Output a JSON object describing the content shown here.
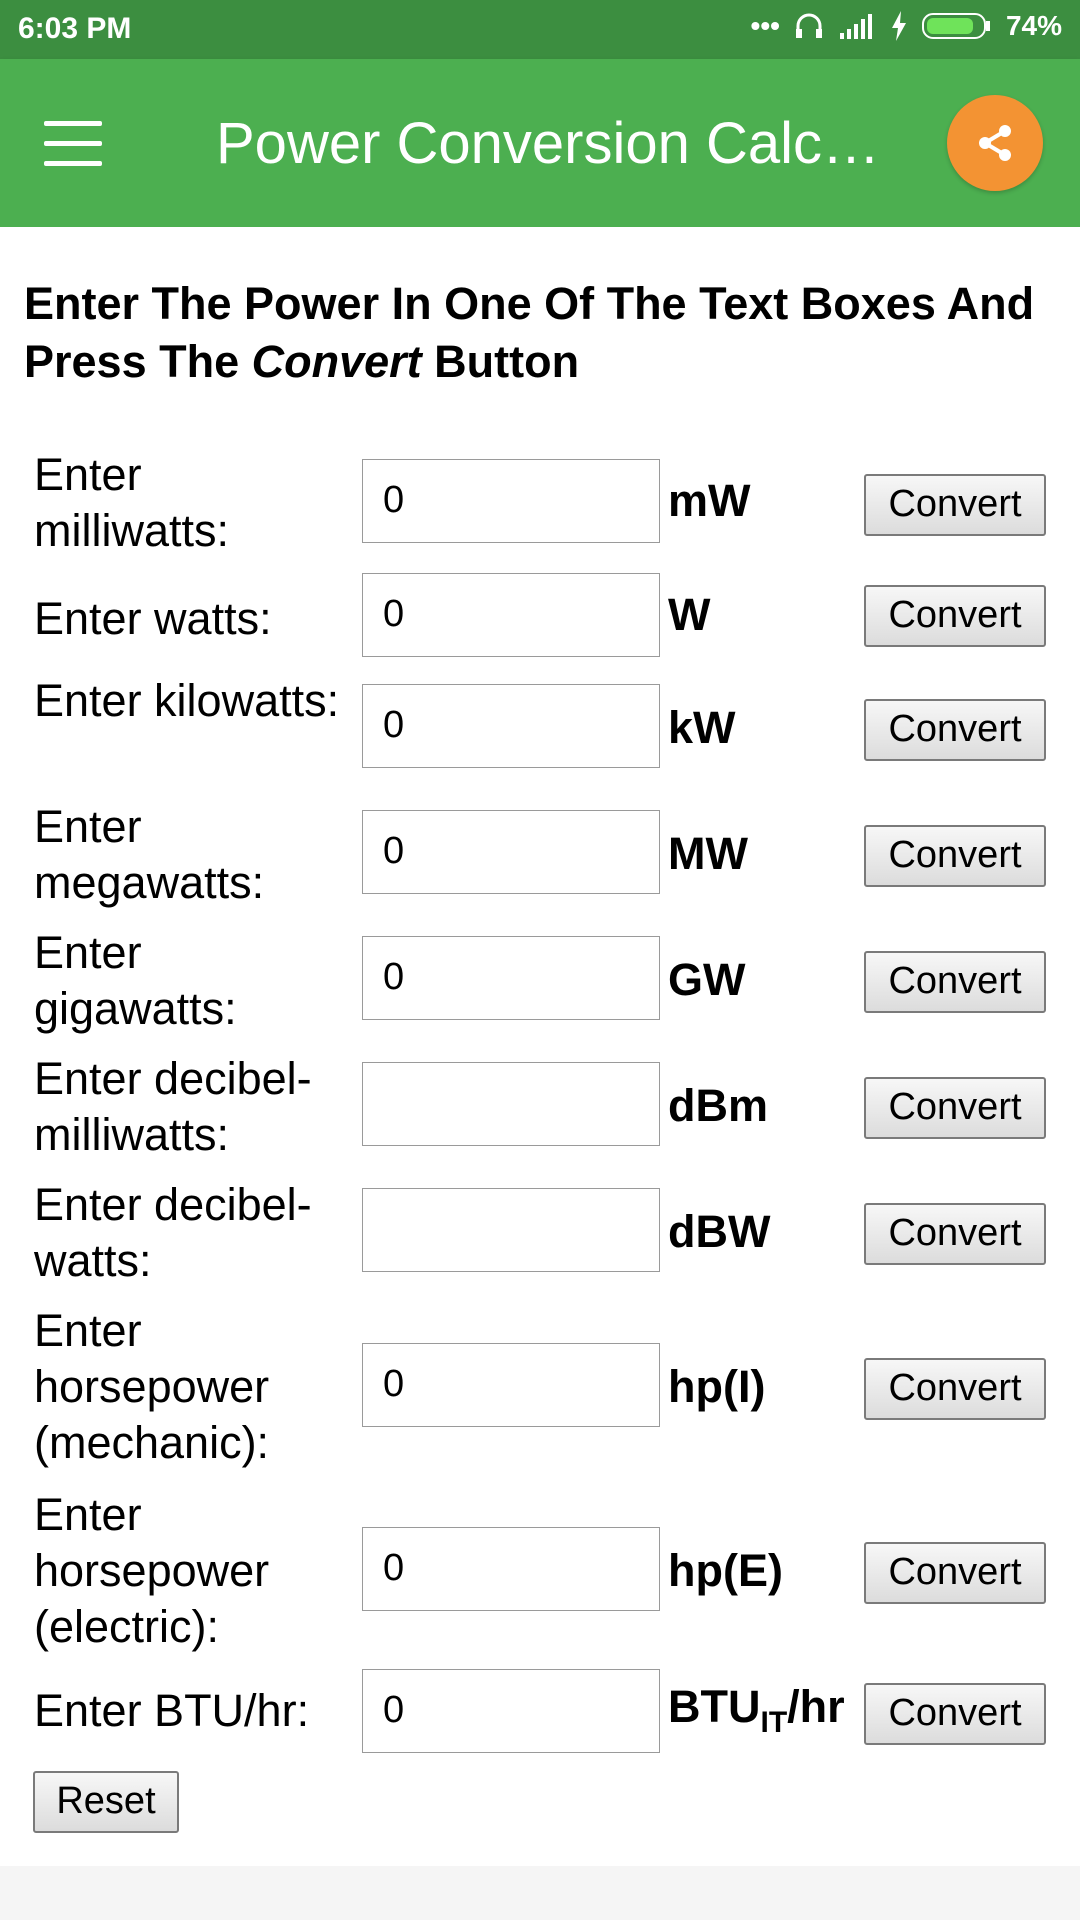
{
  "status_bar": {
    "time": "6:03 PM",
    "battery": "74%"
  },
  "app_bar": {
    "title": "Power Conversion Calc…"
  },
  "intro": {
    "part1": "Enter The Power In One Of The Text Boxes And Press The ",
    "emph": "Convert",
    "part2": " Button"
  },
  "rows": [
    {
      "label": "Enter milliwatts:",
      "value": "0",
      "unit": "mW",
      "button": "Convert"
    },
    {
      "label": "Enter watts:",
      "value": "0",
      "unit": "W",
      "button": "Convert"
    },
    {
      "label": "Enter kilowatts:",
      "value": "0",
      "unit": "kW",
      "button": "Convert"
    },
    {
      "label": "Enter megawatts:",
      "value": "0",
      "unit": "MW",
      "button": "Convert"
    },
    {
      "label": "Enter gigawatts:",
      "value": "0",
      "unit": "GW",
      "button": "Convert"
    },
    {
      "label": "Enter decibel-milliwatts:",
      "value": "",
      "unit": "dBm",
      "button": "Convert"
    },
    {
      "label": "Enter decibel-watts:",
      "value": "",
      "unit": "dBW",
      "button": "Convert"
    },
    {
      "label": "Enter horsepower (mechanic):",
      "value": "0",
      "unit": "hp(I)",
      "button": "Convert"
    },
    {
      "label": "Enter horsepower (electric):",
      "value": "0",
      "unit": "hp(E)",
      "button": "Convert"
    },
    {
      "label": "Enter BTU/hr:",
      "value": "0",
      "unit_main": "BTU",
      "unit_sub": "IT",
      "unit_tail": "/hr",
      "button": "Convert"
    }
  ],
  "reset": {
    "label": "Reset"
  },
  "colors": {
    "appbar": "#4caf50",
    "statusbar": "#3c8e40",
    "share": "#f39333"
  }
}
